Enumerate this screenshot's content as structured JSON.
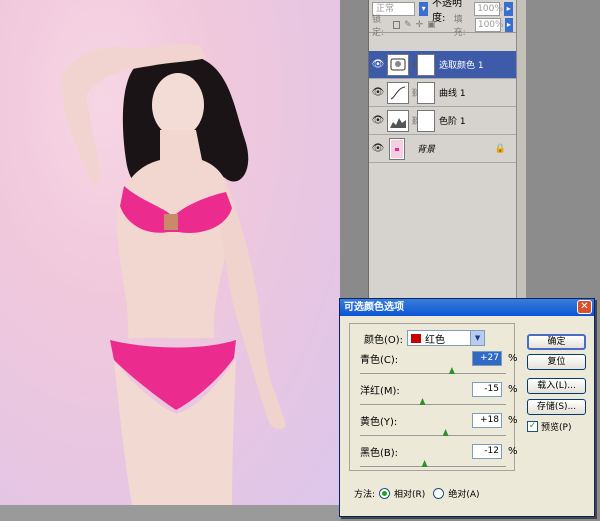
{
  "layers_panel": {
    "blend_mode": "正常",
    "opacity_label": "不透明度:",
    "opacity_value": "100%",
    "lock_label": "锁定:",
    "fill_label": "填充:",
    "fill_value": "100%",
    "layers": [
      {
        "name": "选取颜色 1",
        "selected": true,
        "thumb_icon": "selective-color-icon"
      },
      {
        "name": "曲线 1",
        "selected": false,
        "thumb_icon": "curves-icon"
      },
      {
        "name": "色阶 1",
        "selected": false,
        "thumb_icon": "levels-icon"
      },
      {
        "name": "背景",
        "selected": false,
        "thumb_icon": "photo-thumbnail"
      }
    ]
  },
  "dialog": {
    "title": "可选颜色选项",
    "color_label": "颜色(O):",
    "color_value": "红色",
    "color_swatch": "#c80000",
    "fields": [
      {
        "label": "青色(C):",
        "value": "+27",
        "unit": "%",
        "slider": 0.635
      },
      {
        "label": "洋红(M):",
        "value": "-15",
        "unit": "%",
        "slider": 0.425
      },
      {
        "label": "黄色(Y):",
        "value": "+18",
        "unit": "%",
        "slider": 0.59
      },
      {
        "label": "黑色(B):",
        "value": "-12",
        "unit": "%",
        "slider": 0.44
      }
    ],
    "buttons": {
      "ok": "确定",
      "reset": "复位",
      "load": "载入(L)...",
      "save": "存储(S)..."
    },
    "preview_label": "预览(P)",
    "preview_checked": true,
    "method_label": "方法:",
    "method_relative": "相对(R)",
    "method_absolute": "绝对(A)",
    "method_selected": "relative"
  },
  "colors": {
    "titlebar": "#0a54d6",
    "selected_layer": "#3d5ba9",
    "dialog_bg": "#ece9d8"
  }
}
